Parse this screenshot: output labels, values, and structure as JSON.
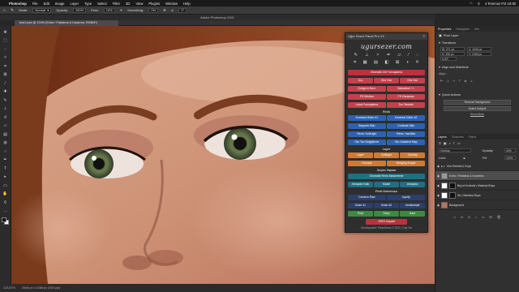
{
  "menubar": {
    "app_name": "Photoshop",
    "items": [
      "File",
      "Edit",
      "Image",
      "Layer",
      "Type",
      "Select",
      "Filter",
      "3D",
      "View",
      "Plugins",
      "Window",
      "Help"
    ],
    "datetime": "4 Temmuz Pzt 18:30"
  },
  "options": {
    "mode_label": "Mode:",
    "mode_value": "Normal",
    "opacity_label": "Opacity:",
    "opacity_value": "100%",
    "flow_label": "Flow:",
    "flow_value": "10%",
    "smoothing_label": "Smoothing:",
    "smoothing_value": "0%",
    "angle_value": "0°"
  },
  "window_title": "Adobe Photoshop 2021",
  "doc_tab": "test1.psd @ 124% (Extra / Parlatma & Kararma, RGB/8*)",
  "status": {
    "zoom": "123,87%",
    "dims": "2848 px x 4288 px (300 ppi)"
  },
  "plugin": {
    "title": "Uğur Sezer Panel Pro V1",
    "logo": "ugursezer.com",
    "btn_oto_cilt": "Otomatik Cilt Yumuşatma",
    "btn_dis": "Dış",
    "btn_goz_hizi": "Göz Hızı",
    "btn_goz_ici": "Göz İnci",
    "btn_dodge": "Dodge & Burn",
    "btn_saturation": "Saturation +/-",
    "btn_fs_median": "FS Median",
    "btn_fs_gaussian": "FS Gaussian",
    "btn_lokal": "Lokal Yumuşatma",
    "btn_toz": "Toz Temizle",
    "hdr_renk": "Renk",
    "btn_kontrast1": "Kontrast Gider #1",
    "btn_kontrast2": "Kontrast Gider #2",
    "btn_beyazla": "Beyazla Stilo",
    "btn_contrast_stilo": "Contrast Stilo",
    "btn_renk_soft": "Renk: SoftLight",
    "btn_renk_hardmix": "Renk: HardMix",
    "btn_oto_ton": "Oto Ton Değiştirme",
    "btn_oto_grad": "Oto Gradient Map",
    "hdr_layer": "Layer",
    "btn_layer": "Layer",
    "btn_softlight": "Softlight",
    "btn_overlay": "Overlay",
    "btn_grouple": "Grouple",
    "btn_bringing": "Bringing Kopya",
    "hdr_secim": "Seçim Yapma",
    "btn_oto_renk": "Otomatik Renk Maskeleme",
    "btn_arkaplan_kalk": "Arkaplan Kalk",
    "btn_masle": "Masle",
    "btn_arkaplan": "Arkaplan",
    "hdr_final": "Final Dokunuşu",
    "btn_camera_raw": "Camera Raw",
    "btn_liquify": "Liquify",
    "btn_grain1": "Grain #1",
    "btn_grain2": "Grain #2",
    "btn_keskinlestir": "Keskinleştir",
    "btn_post": "Post",
    "btn_story": "Story",
    "btn_kare": "Kare",
    "btn_jpeg": "JPEG Kaydet",
    "footer": "Development: PhotoSharo © 2021 | Gay Yar"
  },
  "properties": {
    "tabs": [
      "Properties",
      "Histogram",
      "Info"
    ],
    "pixel_layer": "Pixel Layer",
    "transform": "Transform",
    "w": "W: 271 px",
    "h": "H: 196 px",
    "x": "X: 1045 px",
    "y": "Y: 1045 px",
    "angle": "0,00°",
    "align": "Align and Distribute",
    "align_sub": "Align:",
    "quick_actions": "Quick Actions",
    "remove_bg": "Remove Background",
    "select_subject": "Select Subject",
    "show_more": "Show More"
  },
  "layers": {
    "tabs": [
      "Layers",
      "Channels",
      "Paths"
    ],
    "blend": "Overlay",
    "opacity_label": "Opacity:",
    "opacity": "40%",
    "lock_label": "Lock:",
    "fill_label": "Fill:",
    "fill": "100%",
    "items": [
      "Göz Renkleri | Koyu",
      "Extra / Parlatma & Karartma",
      "Boyut Kontrast | Maskeyi Boya",
      "Siz | Maskeyi Boya",
      "Background"
    ]
  },
  "colors": {
    "accent_red": "#b9333a",
    "accent_blue": "#2d62b0",
    "accent_orange": "#d6782b"
  }
}
